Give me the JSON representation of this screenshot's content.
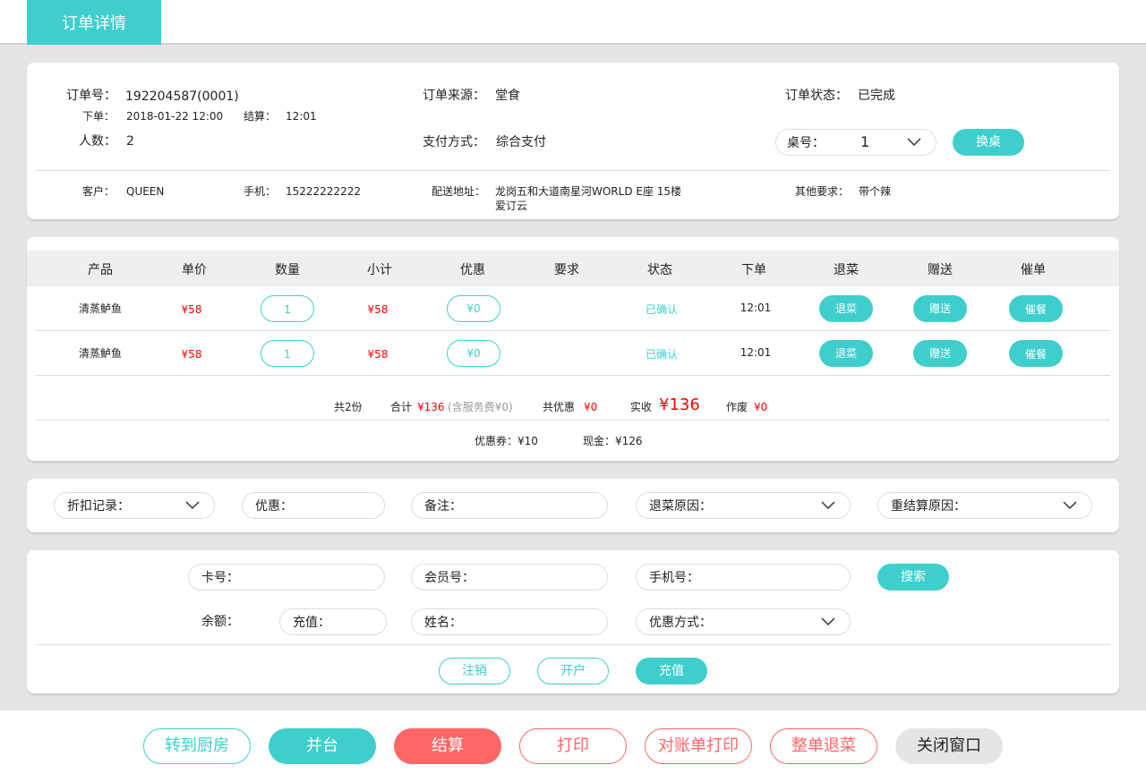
{
  "header": {
    "tab_title": "订单详情"
  },
  "order": {
    "no_label": "订单号：",
    "no_value": "192204587(0001)",
    "placed_label": "下单：",
    "placed_value": "2018-01-22 12:00",
    "settle_label": "结算：",
    "settle_value": "12:01",
    "people_label": "人数：",
    "people_value": "2",
    "source_label": "订单来源：",
    "source_value": "堂食",
    "pay_label": "支付方式：",
    "pay_value": "综合支付",
    "status_label": "订单状态：",
    "status_value": "已完成",
    "table_label": "桌号：",
    "table_value": "1",
    "change_table": "换桌",
    "customer_label": "客户：",
    "customer_value": "QUEEN",
    "phone_label": "手机：",
    "phone_value": "15222222222",
    "address_label": "配送地址：",
    "address_line1": "龙岗五和大道南星河WORLD E座 15楼",
    "address_line2": "爱订云",
    "other_label": "其他要求：",
    "other_value": "带个辣"
  },
  "items": {
    "headers": [
      "产品",
      "单价",
      "数量",
      "小计",
      "优惠",
      "要求",
      "状态",
      "下单",
      "退菜",
      "赠送",
      "催单"
    ],
    "rows": [
      {
        "product": "清蒸鲈鱼",
        "price": "¥58",
        "qty": "1",
        "subtotal": "¥58",
        "discount": "¥0",
        "req": "",
        "status": "已确认",
        "time": "12:01",
        "refund": "退菜",
        "gift": "赠送",
        "urge": "催餐"
      },
      {
        "product": "清蒸鲈鱼",
        "price": "¥58",
        "qty": "1",
        "subtotal": "¥58",
        "discount": "¥0",
        "req": "",
        "status": "已确认",
        "time": "12:01",
        "refund": "退菜",
        "gift": "赠送",
        "urge": "催餐"
      }
    ],
    "summary": {
      "count": "共2份",
      "total_label": "合计",
      "total_value": "¥136",
      "service_note": "(含服务费¥0)",
      "discount_label": "共优惠",
      "discount_value": "¥0",
      "paid_label": "实收",
      "paid_value": "¥136",
      "void_label": "作废",
      "void_value": "¥0"
    },
    "payments": {
      "coupon": "优惠券：¥10",
      "cash": "现金：¥126"
    }
  },
  "filters": {
    "discount_record": "折扣记录：",
    "discount": "优惠：",
    "remark": "备注：",
    "refund_reason": "退菜原因：",
    "resettle_reason": "重结算原因："
  },
  "member": {
    "card_no": "卡号：",
    "member_no": "会员号：",
    "mobile": "手机号：",
    "search": "搜索",
    "balance": "余额：",
    "recharge": "充值：",
    "name": "姓名：",
    "discount_method": "优惠方式：",
    "cancel": "注销",
    "open": "开户",
    "topup": "充值"
  },
  "actions": {
    "to_kitchen": "转到厨房",
    "merge": "并台",
    "settle": "结算",
    "print": "打印",
    "statement_print": "对账单打印",
    "full_refund": "整单退菜",
    "close": "关闭窗口"
  },
  "colors": {
    "accent": "#3ecfcd",
    "danger": "#ff6666",
    "price": "#ff0000"
  }
}
